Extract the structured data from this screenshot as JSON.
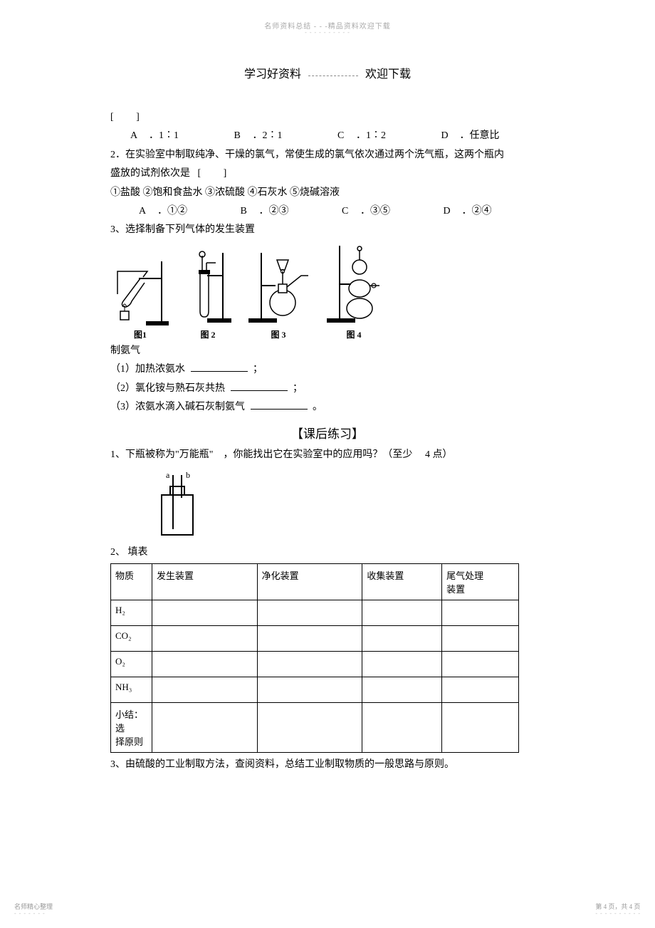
{
  "watermark": {
    "left": "名师资料总结",
    "sep": " - - -",
    "right": "精品资料欢迎下载"
  },
  "header": {
    "left": "学习好资料",
    "right": "欢迎下载"
  },
  "q_bracket": "[          ]",
  "q1_options": [
    {
      "k": "A",
      "v": "．1∶1"
    },
    {
      "k": "B",
      "v": "．2∶1"
    },
    {
      "k": "C",
      "v": "．1∶2"
    },
    {
      "k": "D",
      "v": "．任意比"
    }
  ],
  "q2": {
    "stem1": "2．在实验室中制取纯净、干燥的氯气，常使生成的氯气依次通过两个洗气瓶，这两个瓶内",
    "stem2_a": "盛放的试剂依次是",
    "stem2_b": "[          ]",
    "reagents": "①盐酸   ②饱和食盐水     ③浓硫酸    ④石灰水    ⑤烧碱溶液",
    "options": [
      {
        "k": "A",
        "v": "．①②"
      },
      {
        "k": "B",
        "v": "．②③"
      },
      {
        "k": "C",
        "v": "．③⑤"
      },
      {
        "k": "D",
        "v": "．②④"
      }
    ]
  },
  "q3": {
    "stem": "3、选择制备下列气体的发生装置",
    "figlabels": [
      "图1",
      "图 2",
      "图 3",
      "图 4"
    ],
    "after": "制氨气",
    "items": [
      "（1）加热浓氨水",
      "（2）氯化铵与熟石灰共热",
      "（3）浓氨水滴入碱石灰制氨气"
    ],
    "punct_semi": "；",
    "punct_period": "。"
  },
  "practice_title": "【课后练习】",
  "p1": {
    "a": "1、下瓶被称为\"万能瓶\"",
    "b": "，你能找出它在实验室中的应用吗？（至少",
    "c": "4 点）",
    "port_a": "a",
    "port_b": "b"
  },
  "p2": {
    "stem": "2、 填表"
  },
  "table": {
    "headers": [
      "物质",
      "发生装置",
      "净化装置",
      "收集装置",
      "尾气处理\n装置"
    ],
    "rows": [
      "H₂",
      "CO₂",
      "O₂",
      "NH₃"
    ],
    "summary": "小结：选\n择原则"
  },
  "p3": "3、由硫酸的工业制取方法，查阅资料，总结工业制取物质的一般思路与原则。",
  "footer": {
    "left": "名师精心整理",
    "right": "第 4 页，共 4 页"
  }
}
